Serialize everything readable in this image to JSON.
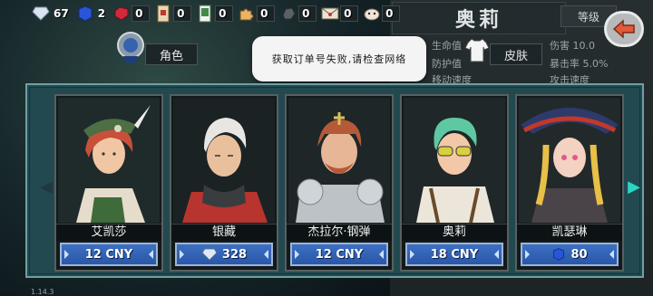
{
  "resources": [
    {
      "icon": "diamond-icon",
      "count": "67"
    },
    {
      "icon": "sapphire-icon",
      "count": "2"
    },
    {
      "icon": "ruby-icon",
      "count": "0"
    },
    {
      "icon": "ticket-icon",
      "count": "0"
    },
    {
      "icon": "card-icon",
      "count": "0"
    },
    {
      "icon": "puzzle-icon",
      "count": "0"
    },
    {
      "icon": "ore-icon",
      "count": "0"
    },
    {
      "icon": "letter-icon",
      "count": "0"
    },
    {
      "icon": "pet-icon",
      "count": "0"
    }
  ],
  "hero_panel": {
    "name": "奥莉",
    "level_label": "等级",
    "stats": [
      "生命值",
      "防护值",
      "移动速度"
    ],
    "stat_values": [
      "伤害 10.0",
      "暴击率 5.0%",
      "攻击速度"
    ]
  },
  "tabs": {
    "role": "角色",
    "skin": "皮肤"
  },
  "toast": "获取订单号失败,请检查网络",
  "characters": [
    {
      "name": "艾凯莎",
      "price": "12 CNY",
      "currency": "cny"
    },
    {
      "name": "银藏",
      "price": "328",
      "currency": "gem"
    },
    {
      "name": "杰拉尔·钢弹",
      "price": "12 CNY",
      "currency": "cny"
    },
    {
      "name": "奥莉",
      "price": "18 CNY",
      "currency": "cny"
    },
    {
      "name": "凯瑟琳",
      "price": "80",
      "currency": "gem"
    }
  ],
  "version": "1.14.3",
  "colors": {
    "panel": "#234950",
    "price_button": "#3c6fc3",
    "accent": "#29d6c5"
  }
}
